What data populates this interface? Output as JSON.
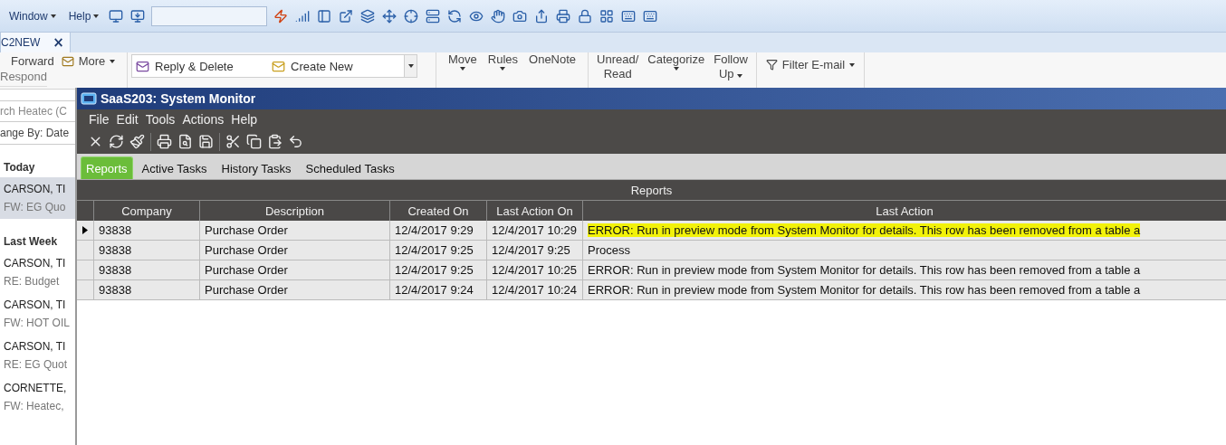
{
  "toolbar": {
    "menus": [
      {
        "label": "Window"
      },
      {
        "label": "Help"
      }
    ]
  },
  "doc_tab": {
    "label": "C2NEW",
    "close": "×"
  },
  "ribbon": {
    "respond": {
      "buttons": [
        "Forward",
        "More"
      ],
      "group": "Respond"
    },
    "quick_steps": [
      "Reply & Delete",
      "Create New"
    ],
    "buttons": [
      {
        "lines": [
          "Move"
        ],
        "dropdown": true
      },
      {
        "lines": [
          "Rules"
        ],
        "dropdown": true
      },
      {
        "lines": [
          "OneNote"
        ],
        "dropdown": false
      },
      {
        "lines": [
          "Unread/",
          "Read"
        ],
        "dropdown": false
      },
      {
        "lines": [
          "Categorize"
        ],
        "dropdown": true
      },
      {
        "lines": [
          "Follow",
          "Up"
        ],
        "dropdown": true
      }
    ],
    "filter": "Filter E-mail"
  },
  "mail_pane": {
    "search": "rch Heatec (C",
    "arrange": "ange By: Date",
    "groups": [
      {
        "title": "Today",
        "items": [
          {
            "from": "CARSON, TI",
            "subject": "FW: EG Quo",
            "selected": true
          }
        ]
      },
      {
        "title": "Last Week",
        "items": [
          {
            "from": "CARSON, TI",
            "subject": "RE: Budget",
            "selected": false
          },
          {
            "from": "CARSON, TI",
            "subject": "FW: HOT OIL",
            "selected": false
          },
          {
            "from": "CARSON, TI",
            "subject": "RE: EG Quot",
            "selected": false
          },
          {
            "from": "CORNETTE,",
            "subject": "FW: Heatec,",
            "selected": false
          }
        ]
      }
    ]
  },
  "monitor": {
    "title": "SaaS203: System Monitor",
    "menu": [
      "File",
      "Edit",
      "Tools",
      "Actions",
      "Help"
    ],
    "tabs": [
      {
        "label": "Reports",
        "selected": true
      },
      {
        "label": "Active Tasks",
        "selected": false
      },
      {
        "label": "History Tasks",
        "selected": false
      },
      {
        "label": "Scheduled Tasks",
        "selected": false
      }
    ],
    "grid_title": "Reports",
    "columns": [
      "Company",
      "Description",
      "Created On",
      "Last Action On",
      "Last Action"
    ],
    "rows": [
      {
        "selected": true,
        "highlighted": true,
        "cells": [
          "93838",
          "Purchase Order",
          "12/4/2017 9:29",
          "12/4/2017 10:29",
          "ERROR: Run in preview mode from System Monitor for details. This row has been removed from a table a"
        ]
      },
      {
        "selected": false,
        "highlighted": false,
        "cells": [
          "93838",
          "Purchase Order",
          "12/4/2017 9:25",
          "12/4/2017 9:25",
          "Process"
        ]
      },
      {
        "selected": false,
        "highlighted": false,
        "cells": [
          "93838",
          "Purchase Order",
          "12/4/2017 9:25",
          "12/4/2017 10:25",
          "ERROR: Run in preview mode from System Monitor for details. This row has been removed from a table a"
        ]
      },
      {
        "selected": false,
        "highlighted": false,
        "cells": [
          "93838",
          "Purchase Order",
          "12/4/2017 9:24",
          "12/4/2017 10:24",
          "ERROR: Run in preview mode from System Monitor for details. This row has been removed from a table a"
        ]
      }
    ]
  }
}
